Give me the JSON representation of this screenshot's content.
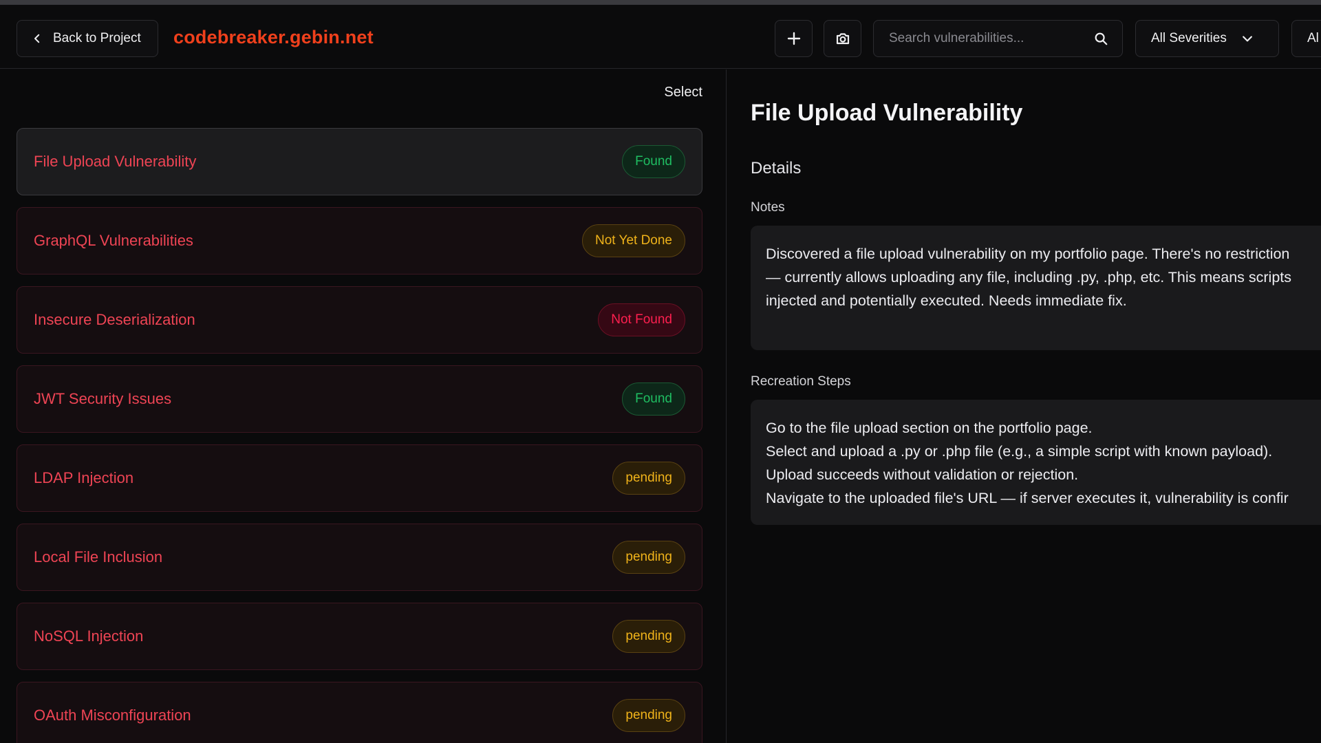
{
  "header": {
    "back_label": "Back to Project",
    "domain": "codebreaker.gebin.net",
    "search_placeholder": "Search vulnerabilities...",
    "severity_filter": "All Severities",
    "status_filter": "Al"
  },
  "list": {
    "select_label": "Select",
    "items": [
      {
        "title": "File Upload Vulnerability",
        "status": "Found"
      },
      {
        "title": "GraphQL Vulnerabilities",
        "status": "Not Yet Done"
      },
      {
        "title": "Insecure Deserialization",
        "status": "Not Found"
      },
      {
        "title": "JWT Security Issues",
        "status": "Found"
      },
      {
        "title": "LDAP Injection",
        "status": "pending"
      },
      {
        "title": "Local File Inclusion",
        "status": "pending"
      },
      {
        "title": "NoSQL Injection",
        "status": "pending"
      },
      {
        "title": "OAuth Misconfiguration",
        "status": "pending"
      }
    ]
  },
  "detail": {
    "title": "File Upload Vulnerability",
    "section": "Details",
    "notes_label": "Notes",
    "notes_lines": [
      "Discovered a file upload vulnerability on my portfolio page. There's no restriction",
      "— currently allows uploading any file, including .py, .php, etc. This means scripts",
      "injected and potentially executed. Needs immediate fix."
    ],
    "steps_label": "Recreation Steps",
    "steps_lines": [
      "Go to the file upload section on the portfolio page.",
      "Select and upload a .py or .php file (e.g., a simple script with known payload).",
      "Upload succeeds without validation or rejection.",
      "Navigate to the uploaded file's URL — if server executes it, vulnerability is confir"
    ]
  },
  "colors": {
    "accent": "#f0401c",
    "item_title": "#ee4454",
    "found": "#1fbe62",
    "pending": "#f0b31a",
    "not_found": "#ff1f4f"
  }
}
